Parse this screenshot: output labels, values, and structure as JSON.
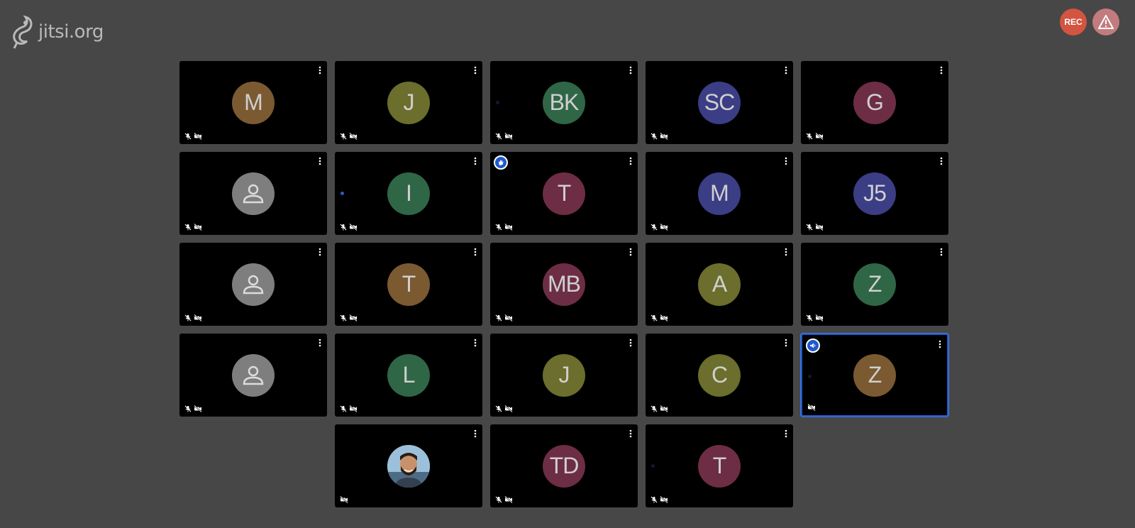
{
  "app": {
    "logo_text": "jitsi.org"
  },
  "toolbar": {
    "rec_label": "REC",
    "warning_icon": "warning-icon"
  },
  "colors": {
    "background": "#474747",
    "tile": "#000000",
    "active_border": "#1f5acc",
    "rec": "#d35440",
    "warning": "#c27b7e"
  },
  "participants": [
    {
      "initials": "M",
      "color": "#7b5a32",
      "muted_audio": true,
      "muted_video": true
    },
    {
      "initials": "J",
      "color": "#6b6e2c",
      "muted_audio": true,
      "muted_video": true
    },
    {
      "initials": "BK",
      "color": "#2f6646",
      "muted_audio": true,
      "muted_video": true,
      "audio_level": "dim"
    },
    {
      "initials": "SC",
      "color": "#3b3d85",
      "muted_audio": true,
      "muted_video": true
    },
    {
      "initials": "G",
      "color": "#6d2d45",
      "muted_audio": true,
      "muted_video": true
    },
    {
      "initials": "",
      "color": "#7e7e7e",
      "generic": true,
      "muted_audio": true,
      "muted_video": true
    },
    {
      "initials": "I",
      "color": "#2f6646",
      "muted_audio": true,
      "muted_video": true,
      "audio_level": "on"
    },
    {
      "initials": "T",
      "color": "#6d2d45",
      "muted_audio": true,
      "muted_video": true,
      "raised_hand": true
    },
    {
      "initials": "M",
      "color": "#3b3d85",
      "muted_audio": true,
      "muted_video": true
    },
    {
      "initials": "J5",
      "color": "#3b3d85",
      "muted_audio": true,
      "muted_video": true
    },
    {
      "initials": "",
      "color": "#7e7e7e",
      "generic": true,
      "muted_audio": true,
      "muted_video": true
    },
    {
      "initials": "T",
      "color": "#7b5a32",
      "muted_audio": true,
      "muted_video": true
    },
    {
      "initials": "MB",
      "color": "#6d2d45",
      "muted_audio": true,
      "muted_video": true
    },
    {
      "initials": "A",
      "color": "#6b6e2c",
      "muted_audio": true,
      "muted_video": true
    },
    {
      "initials": "Z",
      "color": "#2f6646",
      "muted_audio": true,
      "muted_video": true
    },
    {
      "initials": "",
      "color": "#7e7e7e",
      "generic": true,
      "muted_audio": true,
      "muted_video": true
    },
    {
      "initials": "L",
      "color": "#2f6646",
      "muted_audio": true,
      "muted_video": true
    },
    {
      "initials": "J",
      "color": "#6b6e2c",
      "muted_audio": true,
      "muted_video": true
    },
    {
      "initials": "C",
      "color": "#6b6e2c",
      "muted_audio": true,
      "muted_video": true
    },
    {
      "initials": "Z",
      "color": "#7b5a32",
      "muted_audio": false,
      "muted_video": true,
      "active_speaker": true,
      "dominant_speaker_badge": true,
      "audio_level": "dim"
    },
    {
      "initials": "",
      "color": "#8fb3cf",
      "photo": true,
      "muted_audio": false,
      "muted_video": true
    },
    {
      "initials": "TD",
      "color": "#6d2d45",
      "muted_audio": true,
      "muted_video": true
    },
    {
      "initials": "T",
      "color": "#6d2d45",
      "muted_audio": true,
      "muted_video": true,
      "audio_level": "dim"
    }
  ]
}
